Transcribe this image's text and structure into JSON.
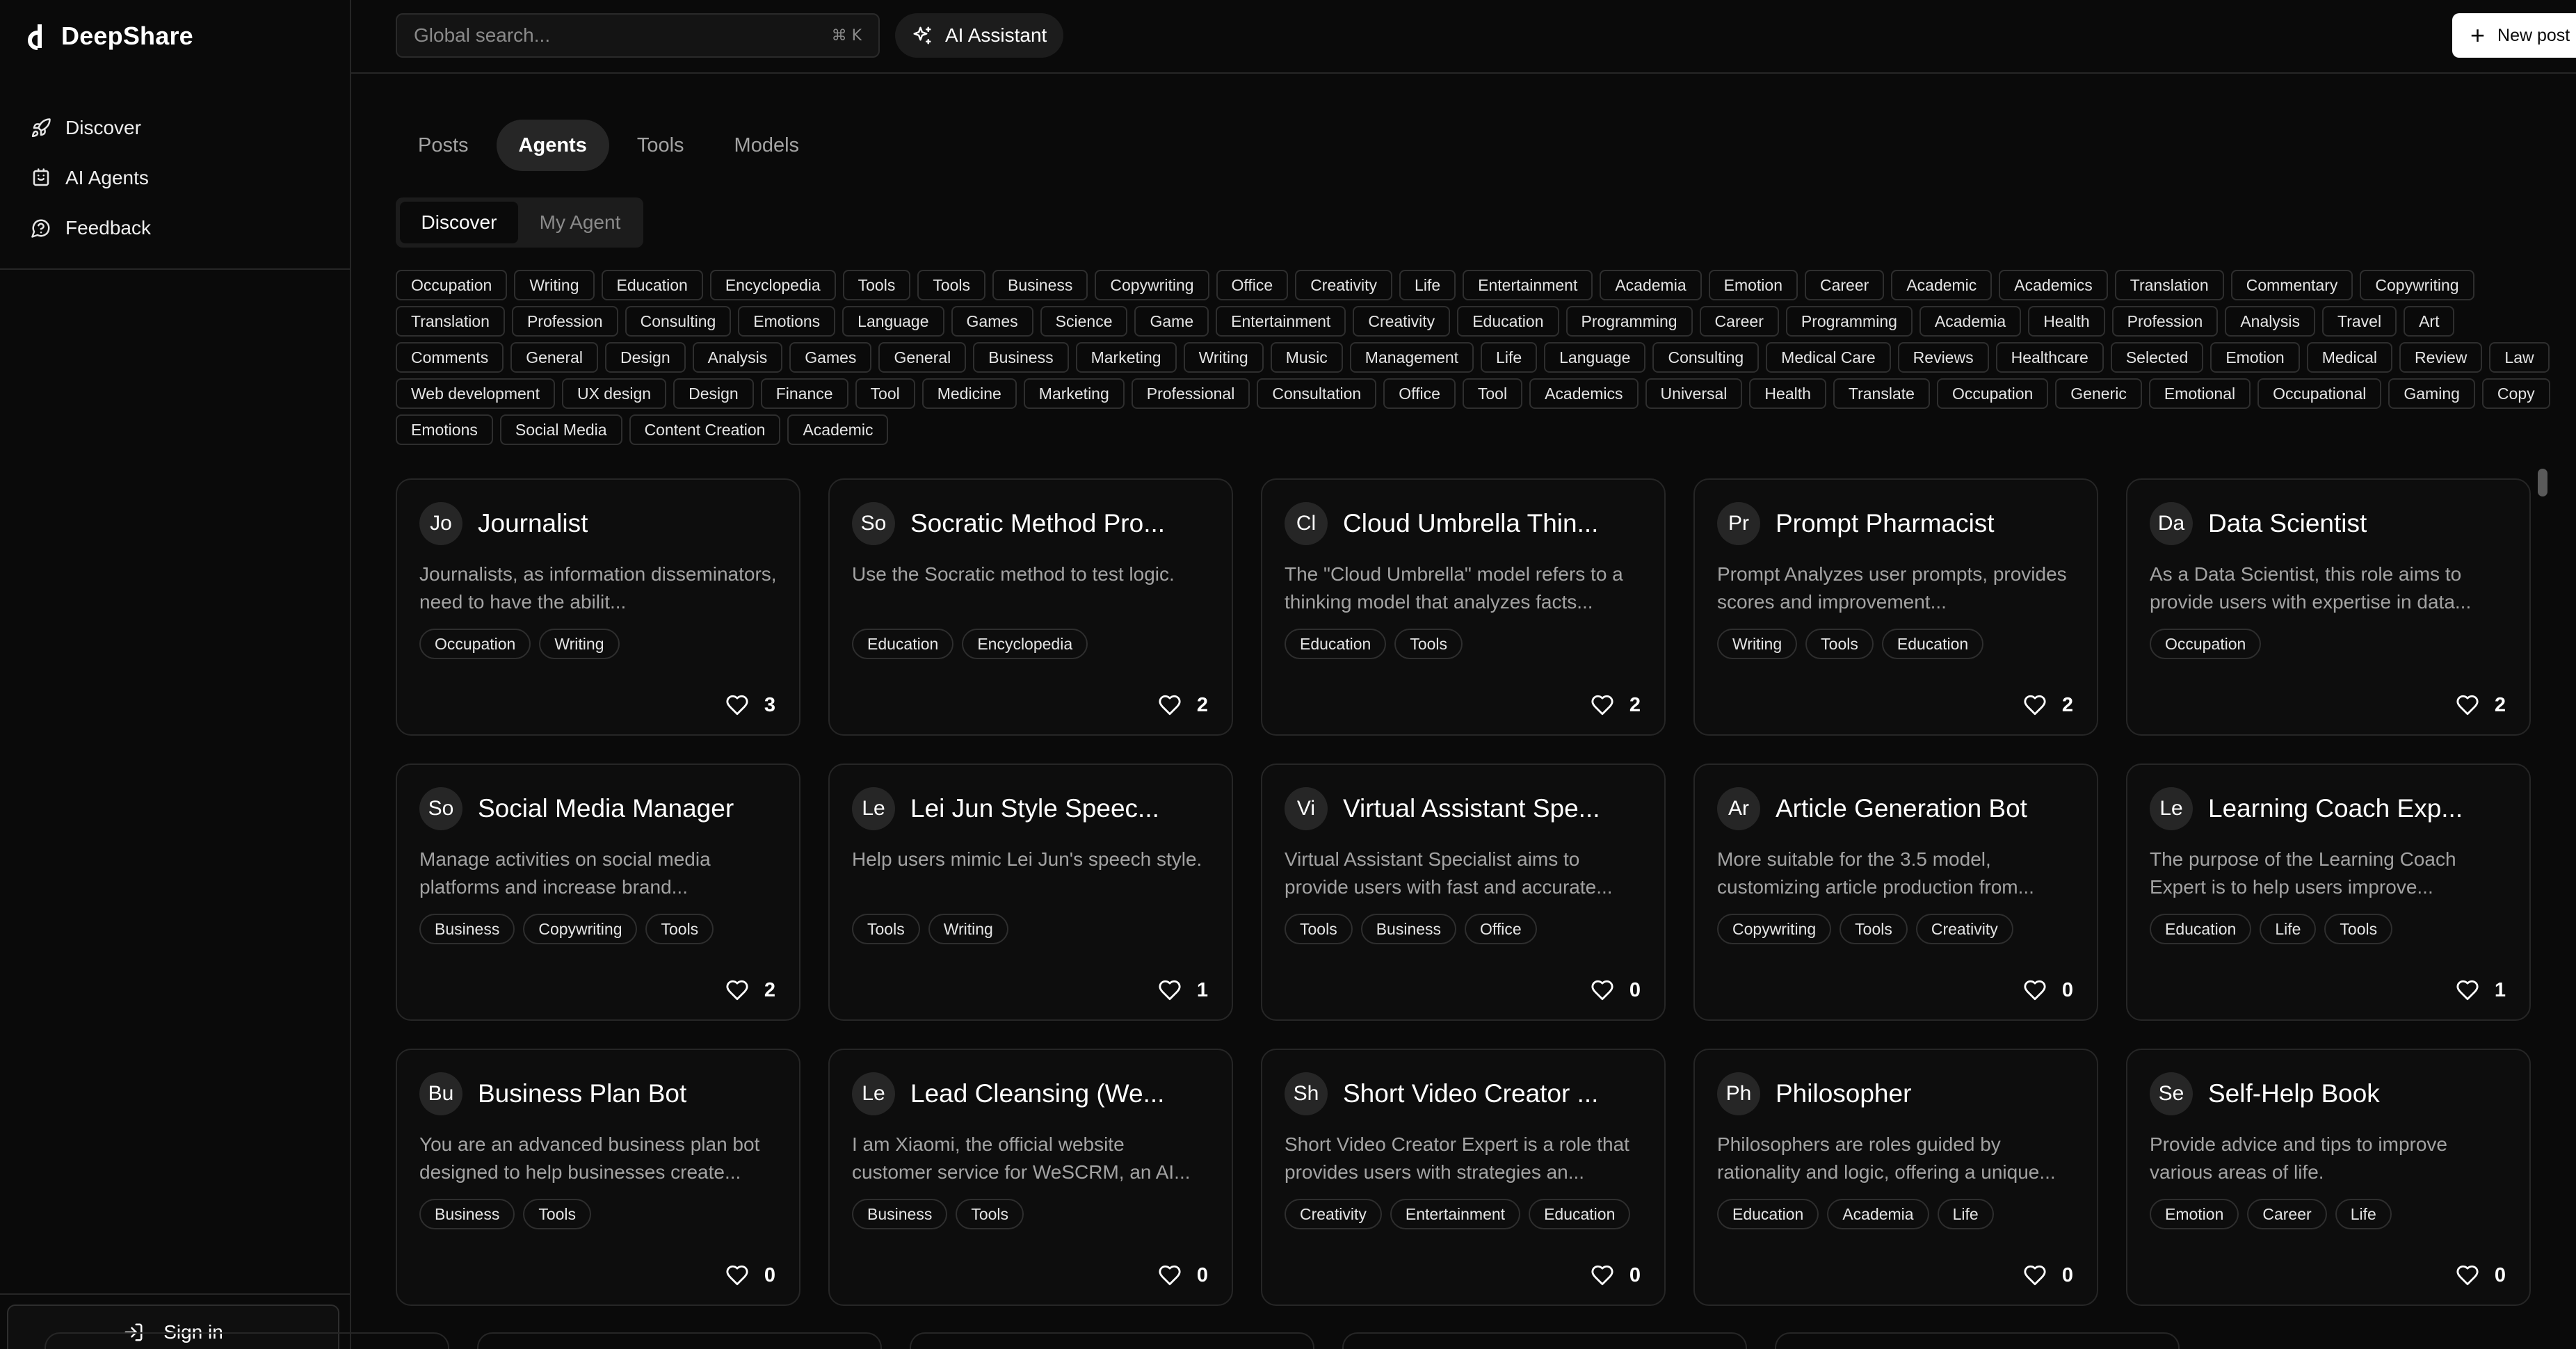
{
  "app": {
    "name": "DeepShare"
  },
  "sidebar": {
    "items": [
      {
        "label": "Discover",
        "icon": "rocket-icon"
      },
      {
        "label": "AI Agents",
        "icon": "bot-icon"
      },
      {
        "label": "Feedback",
        "icon": "message-icon"
      }
    ],
    "signin_label": "Sign in"
  },
  "topbar": {
    "search_placeholder": "Global search...",
    "search_shortcut": "⌘ K",
    "ai_label": "AI Assistant",
    "new_post_label": "New post"
  },
  "tabs": [
    {
      "label": "Posts",
      "active": false
    },
    {
      "label": "Agents",
      "active": true
    },
    {
      "label": "Tools",
      "active": false
    },
    {
      "label": "Models",
      "active": false
    }
  ],
  "subtabs": [
    {
      "label": "Discover",
      "active": true
    },
    {
      "label": "My Agent",
      "active": false
    }
  ],
  "tags": [
    "Occupation",
    "Writing",
    "Education",
    "Encyclopedia",
    "Tools",
    "Tools",
    "Business",
    "Copywriting",
    "Office",
    "Creativity",
    "Life",
    "Entertainment",
    "Academia",
    "Emotion",
    "Career",
    "Academic",
    "Academics",
    "Translation",
    "Commentary",
    "Copywriting",
    "Translation",
    "Profession",
    "Consulting",
    "Emotions",
    "Language",
    "Games",
    "Science",
    "Game",
    "Entertainment",
    "Creativity",
    "Education",
    "Programming",
    "Career",
    "Programming",
    "Academia",
    "Health",
    "Profession",
    "Analysis",
    "Travel",
    "Art",
    "Comments",
    "General",
    "Design",
    "Analysis",
    "Games",
    "General",
    "Business",
    "Marketing",
    "Writing",
    "Music",
    "Management",
    "Life",
    "Language",
    "Consulting",
    "Medical Care",
    "Reviews",
    "Healthcare",
    "Selected",
    "Emotion",
    "Medical",
    "Review",
    "Law",
    "Web development",
    "UX design",
    "Design",
    "Finance",
    "Tool",
    "Medicine",
    "Marketing",
    "Professional",
    "Consultation",
    "Office",
    "Tool",
    "Academics",
    "Universal",
    "Health",
    "Translate",
    "Occupation",
    "Generic",
    "Emotional",
    "Occupational",
    "Gaming",
    "Copy",
    "Emotions",
    "Social Media",
    "Content Creation",
    "Academic"
  ],
  "agents": [
    {
      "initials": "Jo",
      "title": "Journalist",
      "desc": "Journalists, as information disseminators, need to have the abilit...",
      "tags": [
        "Occupation",
        "Writing"
      ],
      "likes": "3"
    },
    {
      "initials": "So",
      "title": "Socratic Method Pro...",
      "desc": "Use the Socratic method to test logic.",
      "tags": [
        "Education",
        "Encyclopedia"
      ],
      "likes": "2"
    },
    {
      "initials": "Cl",
      "title": "Cloud Umbrella Thin...",
      "desc": "The \"Cloud Umbrella\" model refers to a thinking model that analyzes facts...",
      "tags": [
        "Education",
        "Tools"
      ],
      "likes": "2"
    },
    {
      "initials": "Pr",
      "title": "Prompt Pharmacist",
      "desc": "Prompt Analyzes user prompts, provides scores and improvement...",
      "tags": [
        "Writing",
        "Tools",
        "Education"
      ],
      "likes": "2"
    },
    {
      "initials": "Da",
      "title": "Data Scientist",
      "desc": "As a Data Scientist, this role aims to provide users with expertise in data...",
      "tags": [
        "Occupation"
      ],
      "likes": "2"
    },
    {
      "initials": "So",
      "title": "Social Media Manager",
      "desc": "Manage activities on social media platforms and increase brand...",
      "tags": [
        "Business",
        "Copywriting",
        "Tools"
      ],
      "likes": "2"
    },
    {
      "initials": "Le",
      "title": "Lei Jun Style Speec...",
      "desc": "Help users mimic Lei Jun's speech style.",
      "tags": [
        "Tools",
        "Writing"
      ],
      "likes": "1"
    },
    {
      "initials": "Vi",
      "title": "Virtual Assistant Spe...",
      "desc": "Virtual Assistant Specialist aims to provide users with fast and accurate...",
      "tags": [
        "Tools",
        "Business",
        "Office"
      ],
      "likes": "0"
    },
    {
      "initials": "Ar",
      "title": "Article Generation Bot",
      "desc": "More suitable for the 3.5 model, customizing article production from...",
      "tags": [
        "Copywriting",
        "Tools",
        "Creativity"
      ],
      "likes": "0"
    },
    {
      "initials": "Le",
      "title": "Learning Coach Exp...",
      "desc": "The purpose of the Learning Coach Expert is to help users improve...",
      "tags": [
        "Education",
        "Life",
        "Tools"
      ],
      "likes": "1"
    },
    {
      "initials": "Bu",
      "title": "Business Plan Bot",
      "desc": "You are an advanced business plan bot designed to help businesses create...",
      "tags": [
        "Business",
        "Tools"
      ],
      "likes": "0"
    },
    {
      "initials": "Le",
      "title": "Lead Cleansing (We...",
      "desc": "I am Xiaomi, the official website customer service for WeSCRM, an AI...",
      "tags": [
        "Business",
        "Tools"
      ],
      "likes": "0"
    },
    {
      "initials": "Sh",
      "title": "Short Video Creator ...",
      "desc": "Short Video Creator Expert is a role that provides users with strategies an...",
      "tags": [
        "Creativity",
        "Entertainment",
        "Education"
      ],
      "likes": "0"
    },
    {
      "initials": "Ph",
      "title": "Philosopher",
      "desc": "Philosophers are roles guided by rationality and logic, offering a unique...",
      "tags": [
        "Education",
        "Academia",
        "Life"
      ],
      "likes": "0"
    },
    {
      "initials": "Se",
      "title": "Self-Help Book",
      "desc": "Provide advice and tips to improve various areas of life.",
      "tags": [
        "Emotion",
        "Career",
        "Life"
      ],
      "likes": "0"
    }
  ]
}
